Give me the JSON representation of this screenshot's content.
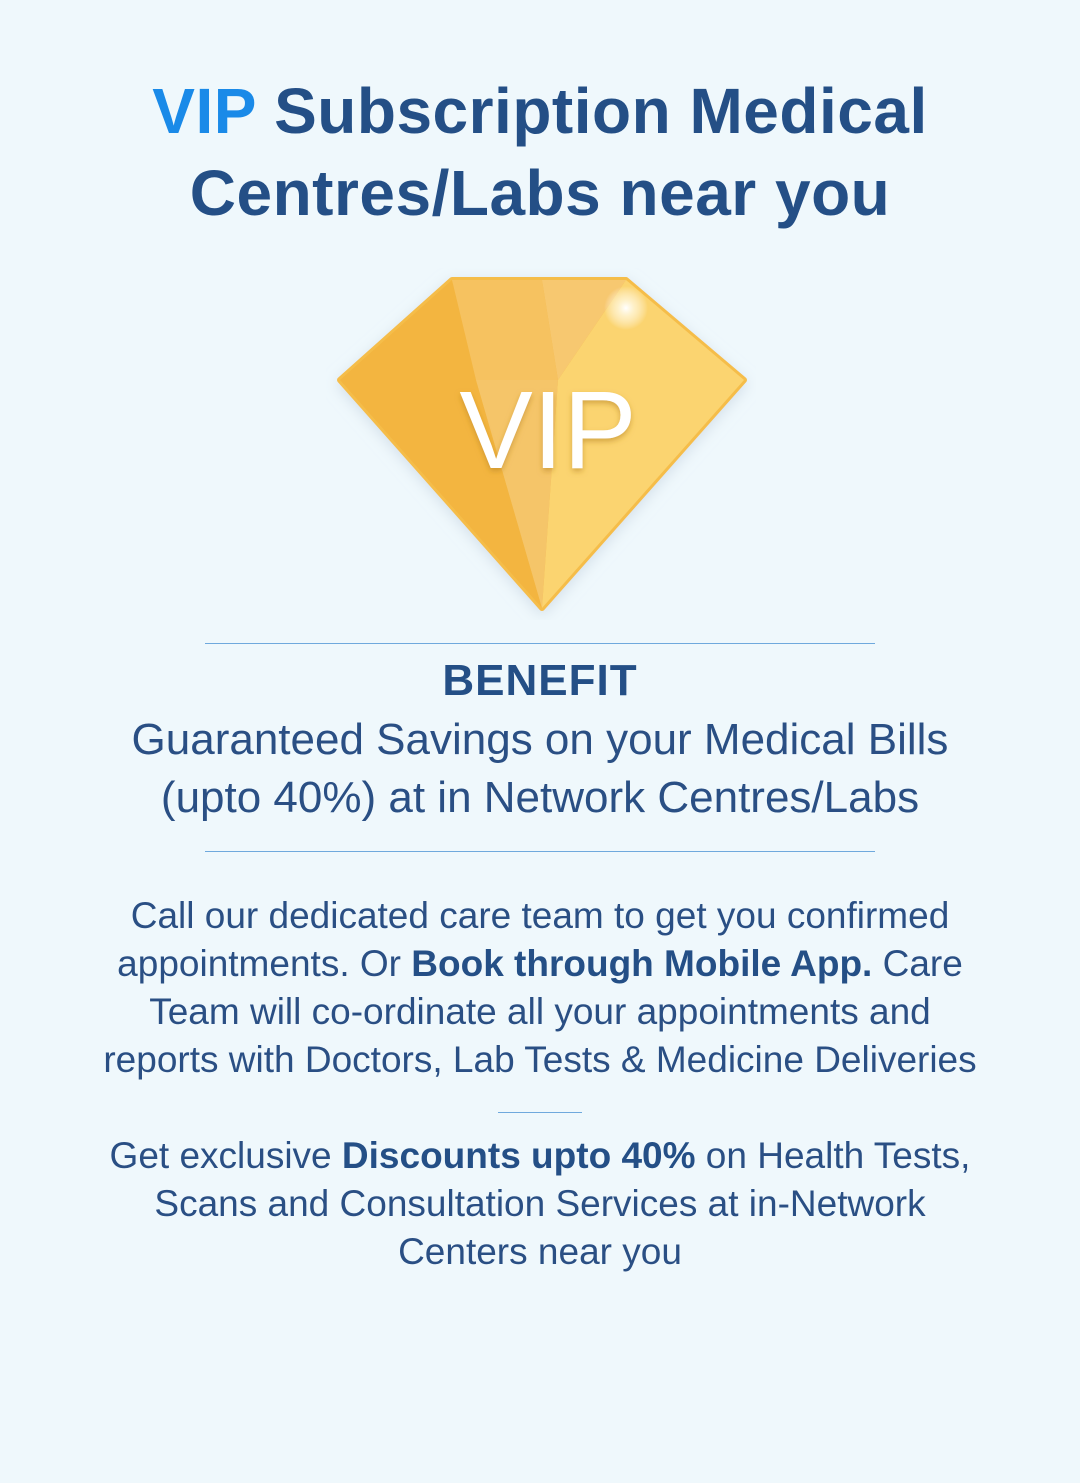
{
  "header": {
    "title_accent": "VIP",
    "title_line1_rest": " Subscription Medical",
    "title_line2": "Centres/Labs near you"
  },
  "badge": {
    "text": "VIP",
    "icon": "diamond-icon"
  },
  "benefit": {
    "heading": "BENEFIT",
    "line1": "Guaranteed Savings on your Medical Bills",
    "line2": "(upto 40%) at in Network Centres/Labs"
  },
  "care": {
    "line1": "Call our dedicated care team to get you confirmed",
    "line2_pre": "appointments. Or ",
    "line2_bold": "Book through Mobile App.",
    "line2_post": " Care",
    "line3": "Team will co-ordinate all your appointments and",
    "line4": "reports with Doctors, Lab Tests & Medicine Deliveries"
  },
  "discount": {
    "line1_pre": "Get exclusive ",
    "line1_bold": "Discounts upto 40%",
    "line1_post": " on Health Tests,",
    "line2": "Scans and Consultation Services at in-Network",
    "line3": "Centers near you"
  },
  "colors": {
    "background": "#eff8fc",
    "title_blue": "#244f86",
    "accent_blue": "#1a8ae8",
    "gold": "#f4b73e",
    "rule": "#6fa9dd"
  }
}
